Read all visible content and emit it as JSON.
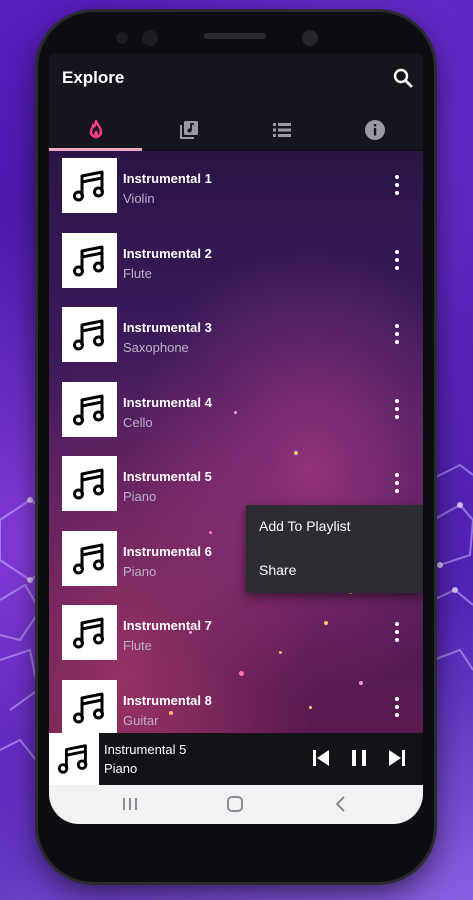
{
  "app": {
    "title": "Explore"
  },
  "tabs": [
    {
      "name": "trending",
      "icon": "flame-icon",
      "active": true
    },
    {
      "name": "albums",
      "icon": "album-icon",
      "active": false
    },
    {
      "name": "list",
      "icon": "list-icon",
      "active": false
    },
    {
      "name": "info",
      "icon": "info-icon",
      "active": false
    }
  ],
  "songs": [
    {
      "title": "Instrumental 1",
      "subtitle": "Violin"
    },
    {
      "title": "Instrumental 2",
      "subtitle": "Flute"
    },
    {
      "title": "Instrumental 3",
      "subtitle": "Saxophone"
    },
    {
      "title": "Instrumental 4",
      "subtitle": "Cello"
    },
    {
      "title": "Instrumental 5",
      "subtitle": "Piano"
    },
    {
      "title": "Instrumental 6",
      "subtitle": "Piano"
    },
    {
      "title": "Instrumental 7",
      "subtitle": "Flute"
    },
    {
      "title": "Instrumental 8",
      "subtitle": "Guitar"
    }
  ],
  "context_menu": {
    "items": [
      "Add To Playlist",
      "Share"
    ]
  },
  "player": {
    "title": "Instrumental 5",
    "subtitle": "Piano"
  },
  "colors": {
    "accent": "#f0a8c2",
    "flame": "#ff3d8b",
    "menu_bg": "#2c2c32"
  }
}
